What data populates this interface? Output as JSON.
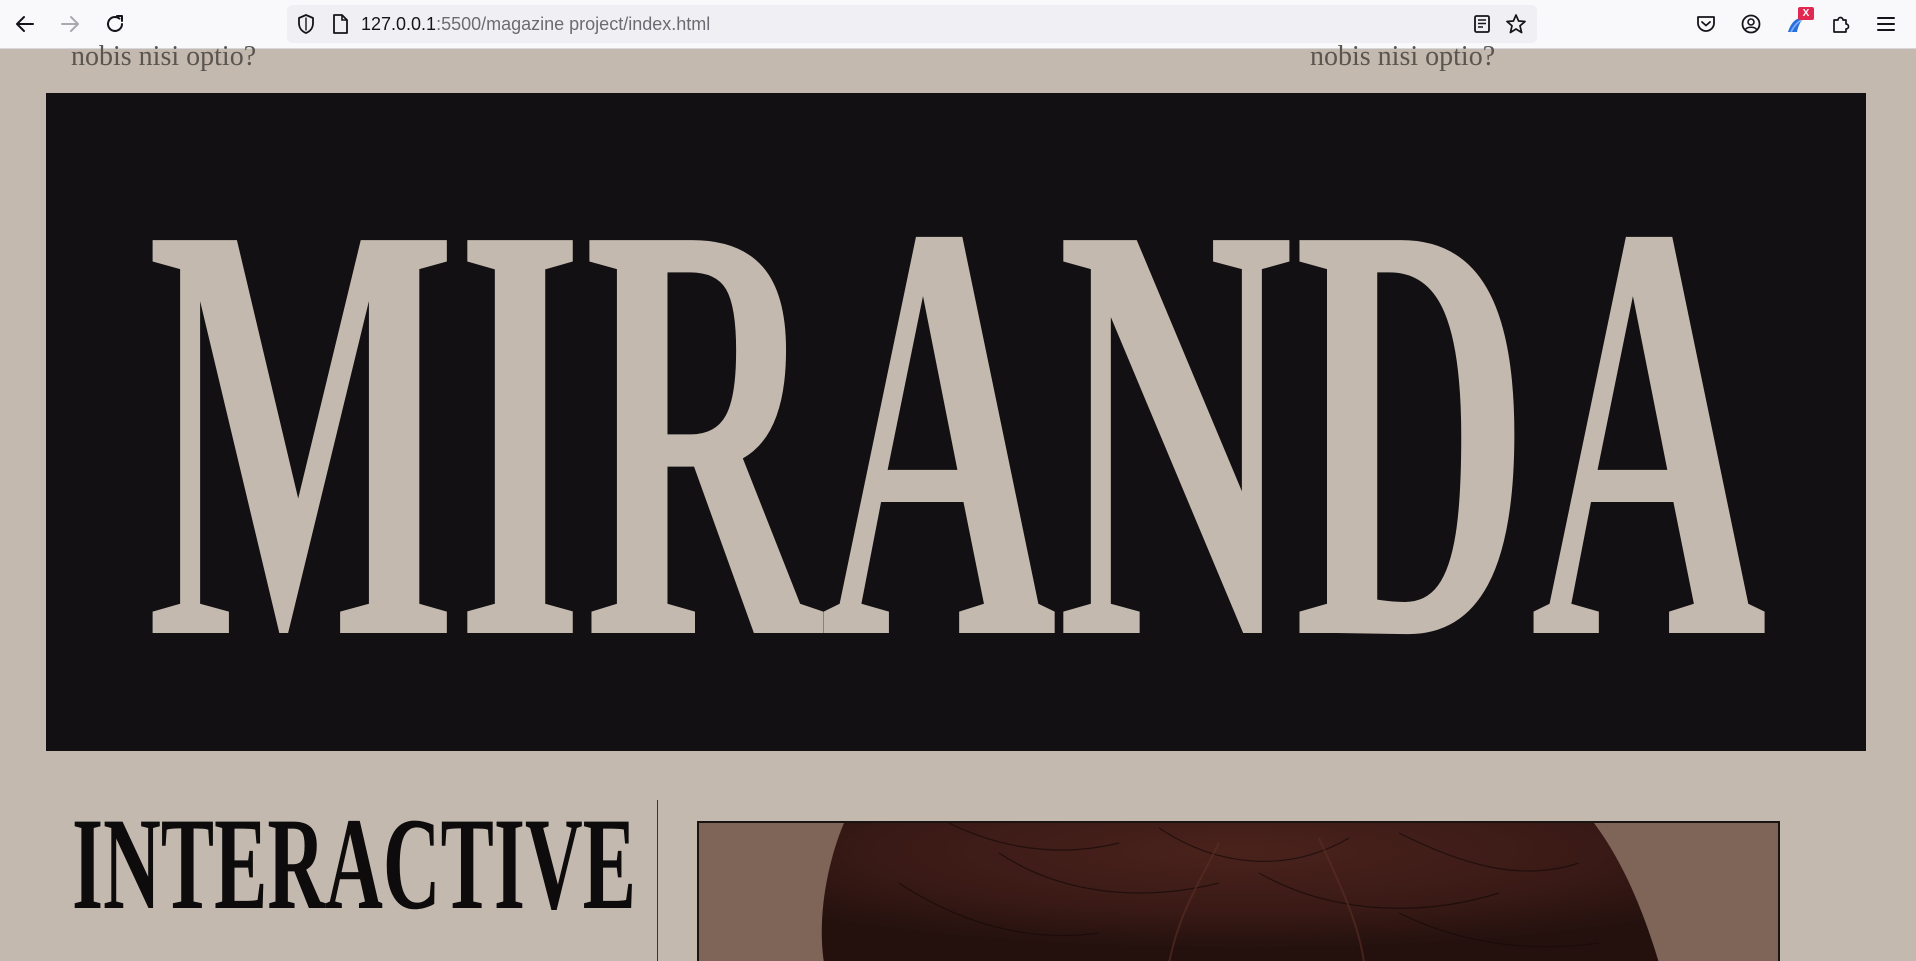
{
  "browser": {
    "url_host": "127.0.0.1",
    "url_path": ":5500/magazine project/index.html",
    "extension_badge": "X",
    "nav": {
      "back_icon": "arrow-left-icon",
      "forward_icon": "arrow-right-icon",
      "reload_icon": "reload-icon"
    },
    "toolbar_icons": [
      "pocket-icon",
      "account-icon",
      "extension-icon",
      "puzzle-icon",
      "menu-icon"
    ]
  },
  "page": {
    "top_text_left": "nobis nisi optio?",
    "top_text_right": "nobis nisi optio?",
    "masthead": "MIRANDA",
    "section_heading": "INTERACTIVE",
    "colors": {
      "background": "#c3b9af",
      "banner": "#121012",
      "masthead_letters": "#c3b9af",
      "heading": "#0d0b0c"
    }
  }
}
